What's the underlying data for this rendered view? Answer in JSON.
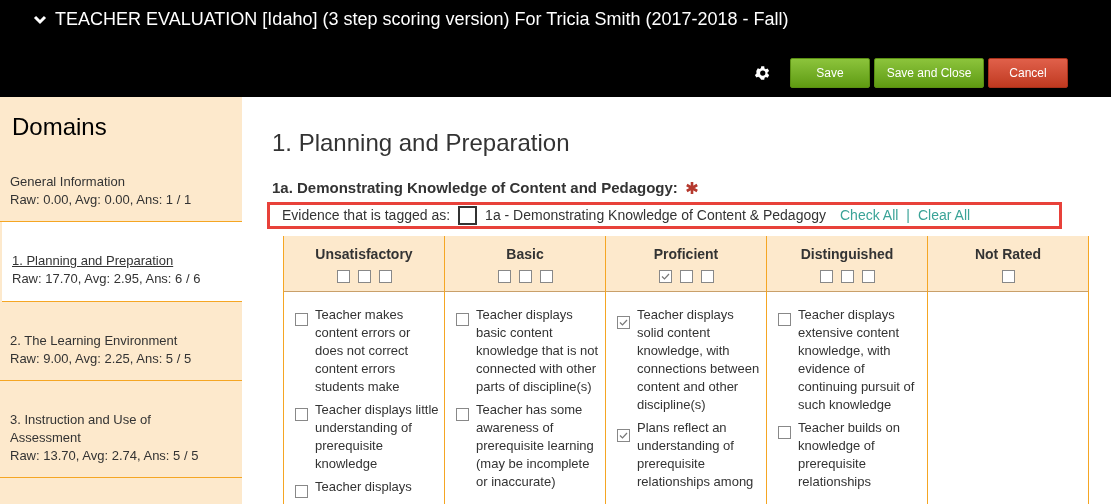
{
  "header": {
    "title": "TEACHER EVALUATION [Idaho] (3 step scoring version) For Tricia Smith (2017-2018 - Fall)",
    "buttons": [
      {
        "label": "Save",
        "kind": "save"
      },
      {
        "label": "Save and Close",
        "kind": "save"
      },
      {
        "label": "Cancel",
        "kind": "cancel"
      }
    ]
  },
  "sidebar": {
    "title": "Domains",
    "items": [
      {
        "name": "General Information",
        "stats": "Raw: 0.00, Avg: 0.00, Ans: 1 / 1",
        "selected": false
      },
      {
        "name": "1. Planning and Preparation",
        "stats": "Raw: 17.70, Avg: 2.95, Ans: 6 / 6",
        "selected": true
      },
      {
        "name": "2. The Learning Environment",
        "stats": "Raw: 9.00, Avg: 2.25, Ans: 5 / 5",
        "selected": false
      },
      {
        "name": "3. Instruction and Use of Assessment",
        "stats": "Raw: 13.70, Avg: 2.74, Ans: 5 / 5",
        "selected": false
      }
    ]
  },
  "main": {
    "heading": "1. Planning and Preparation",
    "subheading": "1a. Demonstrating Knowledge of Content and Pedagogy:",
    "required": true,
    "evidence": {
      "label": "Evidence that is tagged as:",
      "checked": false,
      "tag": "1a - Demonstrating Knowledge of Content & Pedagogy",
      "check_all": "Check All",
      "separator": "|",
      "clear_all": "Clear All"
    },
    "rubric": [
      {
        "name": "Unsatisfactory",
        "boxes": [
          {
            "checked": false
          },
          {
            "checked": false
          },
          {
            "checked": false
          }
        ],
        "items": [
          {
            "text": "Teacher makes content errors or does not correct content errors students make",
            "checked": false
          },
          {
            "text": "Teacher displays little understanding of prerequisite knowledge",
            "checked": false
          },
          {
            "text": "Teacher displays",
            "checked": false
          }
        ]
      },
      {
        "name": "Basic",
        "boxes": [
          {
            "checked": false
          },
          {
            "checked": false
          },
          {
            "checked": false
          }
        ],
        "items": [
          {
            "text": "Teacher displays basic content knowledge that is not connected with other parts of discipline(s)",
            "checked": false
          },
          {
            "text": "Teacher has some awareness of prerequisite learning (may be incomplete or inaccurate)",
            "checked": false
          }
        ]
      },
      {
        "name": "Proficient",
        "boxes": [
          {
            "checked": true
          },
          {
            "checked": false
          },
          {
            "checked": false
          }
        ],
        "items": [
          {
            "text": "Teacher displays solid content knowledge, with connections between content and other discipline(s)",
            "checked": true
          },
          {
            "text": "Plans reflect an understanding of prerequisite relationships among",
            "checked": true
          }
        ]
      },
      {
        "name": "Distinguished",
        "boxes": [
          {
            "checked": false
          },
          {
            "checked": false
          },
          {
            "checked": false
          }
        ],
        "items": [
          {
            "text": "Teacher displays extensive content knowledge, with evidence of continuing pursuit of such knowledge",
            "checked": false
          },
          {
            "text": "Teacher builds on knowledge of prerequisite relationships",
            "checked": false
          }
        ]
      },
      {
        "name": "Not Rated",
        "boxes": [
          {
            "checked": false
          }
        ]
      }
    ]
  }
}
